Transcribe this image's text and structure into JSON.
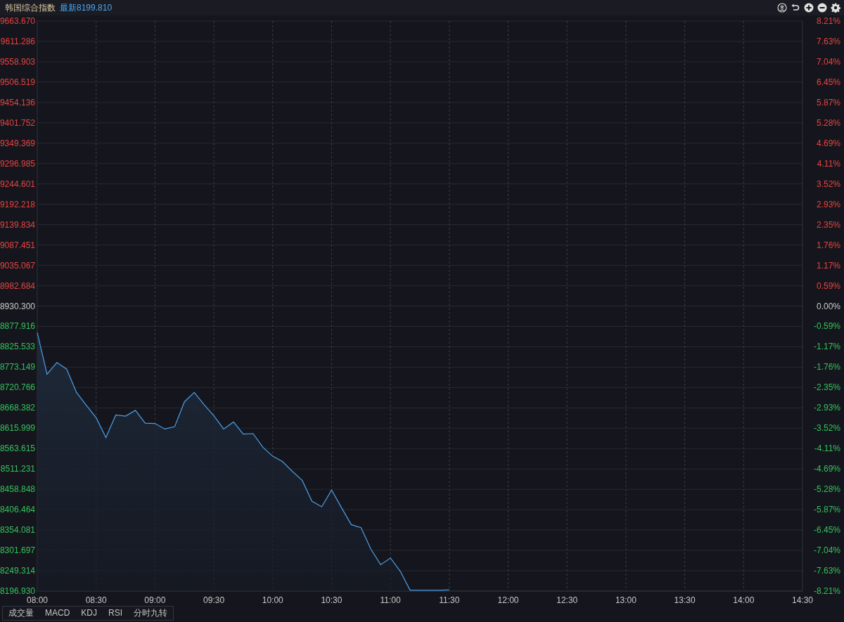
{
  "header": {
    "title": "韩国综合指数",
    "latest": "最新8199.810"
  },
  "chart": {
    "chart_data": {
      "type": "area",
      "grid": true,
      "ylim": [
        8196.93,
        9663.67
      ],
      "categories": [
        "08:00",
        null,
        null,
        null,
        null,
        null,
        "08:30",
        null,
        null,
        null,
        null,
        null,
        "09:00",
        null,
        null,
        null,
        null,
        null,
        "09:30",
        null,
        null,
        null,
        null,
        null,
        "10:00",
        null,
        null,
        null,
        null,
        null,
        "10:30",
        null,
        null,
        null,
        null,
        null,
        "11:00",
        null,
        null,
        null,
        null,
        null,
        "11:30",
        null,
        null,
        null,
        null,
        null,
        "12:00",
        null,
        null,
        null,
        null,
        null,
        "12:30",
        null,
        null,
        null,
        null,
        null,
        "13:00",
        null,
        null,
        null,
        null,
        null,
        "13:30",
        null,
        null,
        null,
        null,
        null,
        "14:00",
        null,
        null,
        null,
        null,
        null,
        "14:30"
      ],
      "yticks": [
        {
          "value": 9663.67,
          "label": "9663.670"
        },
        {
          "value": 9611.286,
          "label": "9611.286"
        },
        {
          "value": 9558.903,
          "label": "9558.903"
        },
        {
          "value": 9506.519,
          "label": "9506.519"
        },
        {
          "value": 9454.136,
          "label": "9454.136"
        },
        {
          "value": 9401.752,
          "label": "9401.752"
        },
        {
          "value": 9349.369,
          "label": "9349.369"
        },
        {
          "value": 9296.985,
          "label": "9296.985"
        },
        {
          "value": 9244.601,
          "label": "9244.601"
        },
        {
          "value": 9192.218,
          "label": "9192.218"
        },
        {
          "value": 9139.834,
          "label": "9139.834"
        },
        {
          "value": 9087.451,
          "label": "9087.451"
        },
        {
          "value": 9035.067,
          "label": "9035.067"
        },
        {
          "value": 8982.684,
          "label": "8982.684"
        },
        {
          "value": 8930.3,
          "label": "8930.300"
        },
        {
          "value": 8877.916,
          "label": "8877.916"
        },
        {
          "value": 8825.533,
          "label": "8825.533"
        },
        {
          "value": 8773.149,
          "label": "8773.149"
        },
        {
          "value": 8720.766,
          "label": "8720.766"
        },
        {
          "value": 8668.382,
          "label": "8668.382"
        },
        {
          "value": 8615.999,
          "label": "8615.999"
        },
        {
          "value": 8563.615,
          "label": "8563.615"
        },
        {
          "value": 8511.231,
          "label": "8511.231"
        },
        {
          "value": 8458.848,
          "label": "8458.848"
        },
        {
          "value": 8406.464,
          "label": "8406.464"
        },
        {
          "value": 8354.081,
          "label": "8354.081"
        },
        {
          "value": 8301.697,
          "label": "8301.697"
        },
        {
          "value": 8249.314,
          "label": "8249.314"
        },
        {
          "value": 8196.93,
          "label": "8196.930"
        }
      ],
      "series": [
        {
          "color": "#4c9fe6",
          "values": [
            8862,
            8755,
            8785,
            8768,
            8708,
            8675,
            8643,
            8592,
            8650,
            8647,
            8662,
            8629,
            8628,
            8614,
            8620,
            8684,
            8708,
            8677,
            8648,
            8614,
            8632,
            8601,
            8602,
            8567,
            8544,
            8530,
            8505,
            8482,
            8428,
            8414,
            8457,
            8412,
            8368,
            8360,
            8305,
            8265,
            8282,
            8248,
            8199,
            8199,
            8199,
            8199,
            8200,
            null,
            null,
            null,
            null,
            null,
            null,
            null,
            null,
            null,
            null,
            null,
            null,
            null,
            null,
            null,
            null,
            null,
            null,
            null,
            null,
            null,
            null,
            null,
            null,
            null,
            null,
            null,
            null,
            null,
            null,
            null,
            null,
            null,
            null,
            null,
            null
          ]
        }
      ]
    },
    "percent_labels": [
      {
        "label": "8.21%",
        "color": "#e8423f"
      },
      {
        "label": "7.63%",
        "color": "#e8423f"
      },
      {
        "label": "7.04%",
        "color": "#e8423f"
      },
      {
        "label": "6.45%",
        "color": "#e8423f"
      },
      {
        "label": "5.87%",
        "color": "#e8423f"
      },
      {
        "label": "5.28%",
        "color": "#e8423f"
      },
      {
        "label": "4.69%",
        "color": "#e8423f"
      },
      {
        "label": "4.11%",
        "color": "#e8423f"
      },
      {
        "label": "3.52%",
        "color": "#e8423f"
      },
      {
        "label": "2.93%",
        "color": "#e8423f"
      },
      {
        "label": "2.35%",
        "color": "#e8423f"
      },
      {
        "label": "1.76%",
        "color": "#e8423f"
      },
      {
        "label": "1.17%",
        "color": "#e8423f"
      },
      {
        "label": "0.59%",
        "color": "#e8423f"
      },
      {
        "label": "0.00%",
        "color": "#c9c9c9"
      },
      {
        "label": "-0.59%",
        "color": "#33c25b"
      },
      {
        "label": "-1.17%",
        "color": "#33c25b"
      },
      {
        "label": "-1.76%",
        "color": "#33c25b"
      },
      {
        "label": "-2.35%",
        "color": "#33c25b"
      },
      {
        "label": "-2.93%",
        "color": "#33c25b"
      },
      {
        "label": "-3.52%",
        "color": "#33c25b"
      },
      {
        "label": "-4.11%",
        "color": "#33c25b"
      },
      {
        "label": "-4.69%",
        "color": "#33c25b"
      },
      {
        "label": "-5.28%",
        "color": "#33c25b"
      },
      {
        "label": "-5.87%",
        "color": "#33c25b"
      },
      {
        "label": "-6.45%",
        "color": "#33c25b"
      },
      {
        "label": "-7.04%",
        "color": "#33c25b"
      },
      {
        "label": "-7.63%",
        "color": "#33c25b"
      },
      {
        "label": "-8.21%",
        "color": "#33c25b"
      }
    ]
  },
  "tabs": [
    {
      "label": "成交量",
      "selected": false
    },
    {
      "label": "MACD",
      "selected": false
    },
    {
      "label": "KDJ",
      "selected": false
    },
    {
      "label": "RSI",
      "selected": false
    },
    {
      "label": "分时九转",
      "selected": false
    }
  ]
}
